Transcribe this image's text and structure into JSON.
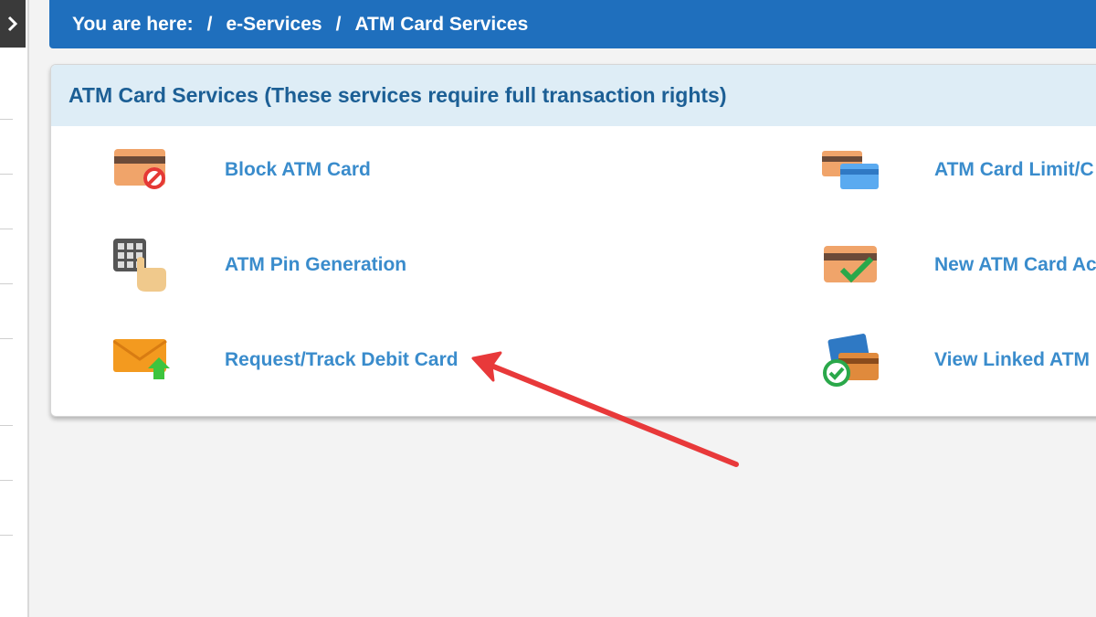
{
  "breadcrumb": {
    "prefix": "You are here:",
    "separator": "/",
    "items": [
      "e-Services",
      "ATM Card Services"
    ]
  },
  "panel": {
    "title": "ATM Card Services (These services require full transaction rights)"
  },
  "services": {
    "left": [
      {
        "label": "Block ATM Card",
        "icon": "block-card-icon"
      },
      {
        "label": "ATM Pin Generation",
        "icon": "keypad-pin-icon"
      },
      {
        "label": "Request/Track Debit Card",
        "icon": "envelope-upload-icon"
      }
    ],
    "right": [
      {
        "label": "ATM Card Limit/C",
        "icon": "card-limit-icon"
      },
      {
        "label": "New ATM Card Ac",
        "icon": "card-activate-icon"
      },
      {
        "label": "View Linked ATM",
        "icon": "linked-cards-icon"
      }
    ]
  },
  "colors": {
    "breadcrumb_bg": "#1f6fbd",
    "header_bg": "#deedf6",
    "title_text": "#1c5f95",
    "link_text": "#3a8ccc",
    "arrow": "#e8393a"
  }
}
